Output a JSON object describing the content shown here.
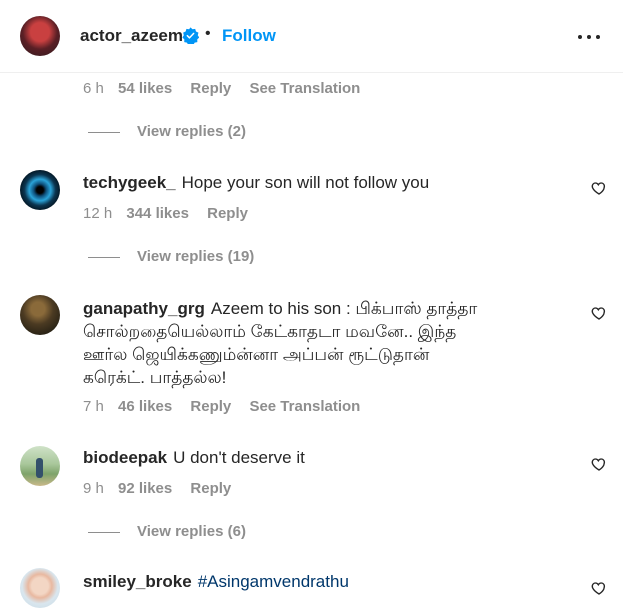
{
  "post_header": {
    "username": "actor_azeem",
    "separator": "•",
    "follow_label": "Follow"
  },
  "first_meta": {
    "time": "6 h",
    "likes": "54 likes",
    "reply": "Reply",
    "translation": "See Translation"
  },
  "view_replies_1": "View replies (2)",
  "comments": [
    {
      "username": "techygeek_",
      "text": "Hope your son will not follow you",
      "time": "12 h",
      "likes": "344 likes",
      "reply": "Reply",
      "view_replies": "View replies (19)"
    },
    {
      "username": "ganapathy_grg",
      "text_line1": "Azeem to his son : பிக்பாஸ் தாத்தா",
      "text_line2": "சொல்றதையெல்லாம் கேட்காதடா மவனே.. இந்த",
      "text_line3": "ஊர்ல ஜெயிக்கணும்ன்னா அப்பன் ரூட்டுதான்",
      "text_line4": "கரெக்ட். பாத்தல்ல!",
      "time": "7 h",
      "likes": "46 likes",
      "reply": "Reply",
      "translation": "See Translation"
    },
    {
      "username": "biodeepak",
      "text": "U don't deserve it",
      "time": "9 h",
      "likes": "92 likes",
      "reply": "Reply",
      "view_replies": "View replies (6)"
    },
    {
      "username": "smiley_broke",
      "text": "#Asingamvendrathu"
    }
  ],
  "colors": {
    "accent": "#0095f6",
    "muted": "#8e8e8e",
    "text": "#262626",
    "hashtag": "#00376b"
  }
}
